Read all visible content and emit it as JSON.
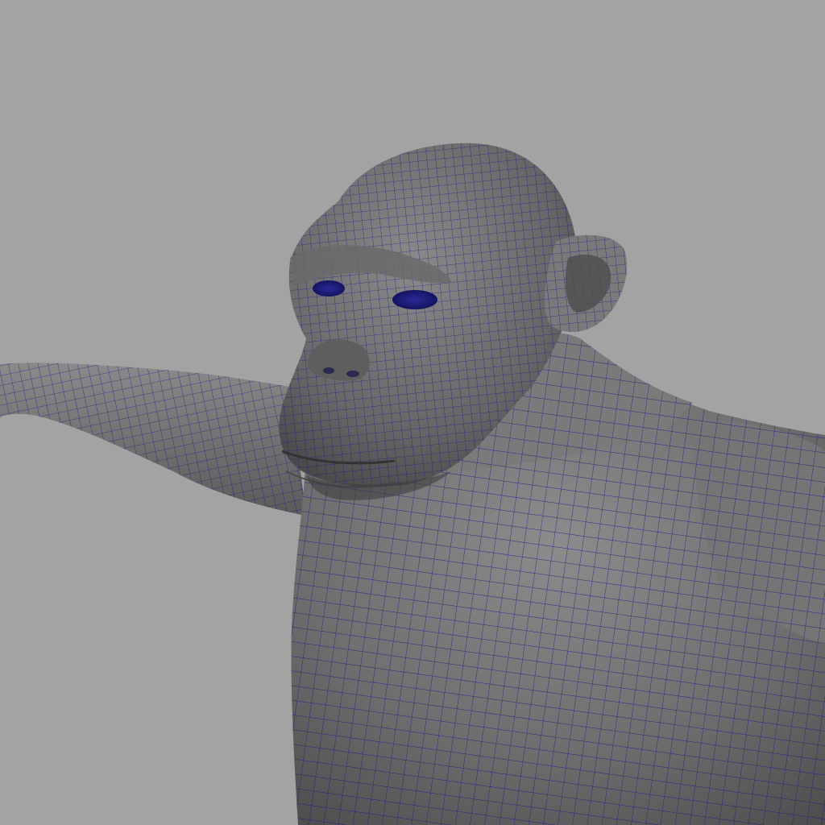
{
  "viewport": {
    "background_color": "#a3a3a3",
    "mesh_surface_color": "#777777",
    "wireframe_color": "#1a1a8a",
    "display_mode": "smooth-shade-with-wireframe"
  },
  "model": {
    "subject": "chimpanzee",
    "parts": [
      "head",
      "brow",
      "eyes",
      "nose",
      "mouth",
      "ear",
      "neck",
      "torso",
      "left-arm",
      "right-shoulder"
    ]
  }
}
